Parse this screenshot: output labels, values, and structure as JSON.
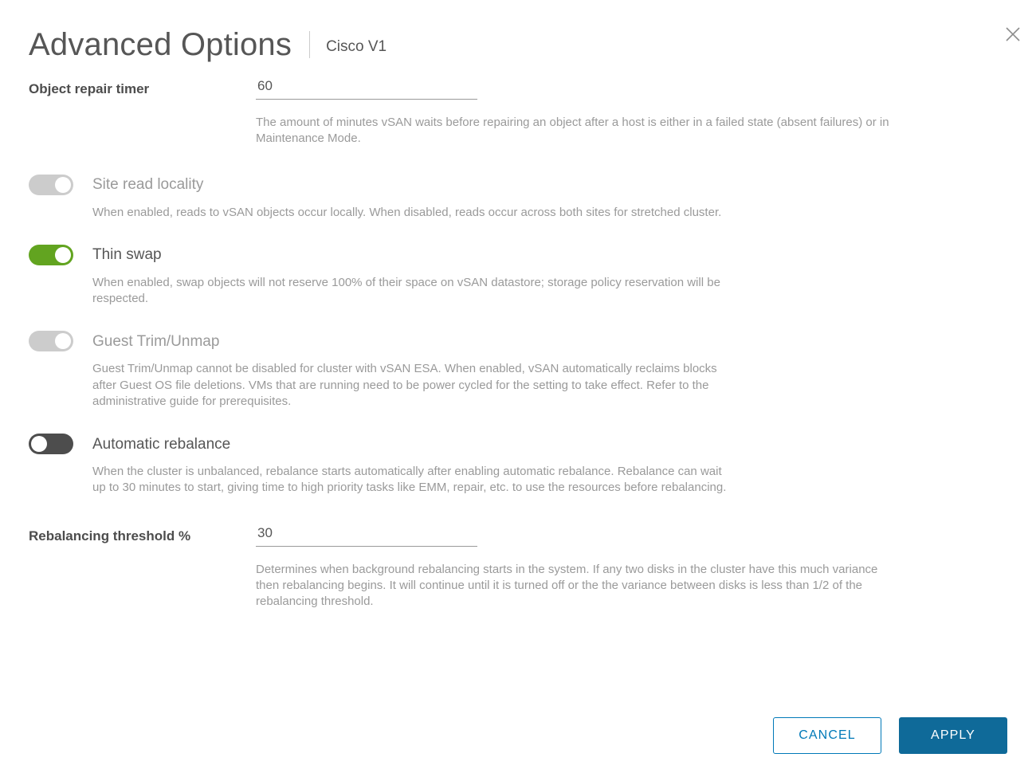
{
  "header": {
    "title": "Advanced Options",
    "subtitle": "Cisco V1",
    "close_icon": "close-icon"
  },
  "fields": {
    "object_repair_timer": {
      "label": "Object repair timer",
      "value": "60",
      "placeholder": "",
      "helper": "The amount of minutes vSAN waits before repairing an object after a host is either in a failed state (absent failures) or in Maintenance Mode."
    },
    "rebalancing_threshold": {
      "label": "Rebalancing threshold %",
      "value": "30",
      "placeholder": "",
      "helper": "Determines when background rebalancing starts in the system. If any two disks in the cluster have this much variance then rebalancing begins. It will continue until it is turned off or the the variance between disks is less than 1/2 of the rebalancing threshold."
    }
  },
  "toggles": {
    "site_read_locality": {
      "label": "Site read locality",
      "state": "on",
      "disabled": true,
      "helper": "When enabled, reads to vSAN objects occur locally. When disabled, reads occur across both sites for stretched cluster."
    },
    "thin_swap": {
      "label": "Thin swap",
      "state": "on",
      "disabled": false,
      "helper": "When enabled, swap objects will not reserve 100% of their space on vSAN datastore; storage policy reservation will be respected."
    },
    "guest_trim_unmap": {
      "label": "Guest Trim/Unmap",
      "state": "on",
      "disabled": true,
      "helper": "Guest Trim/Unmap cannot be disabled for cluster with vSAN ESA. When enabled, vSAN automatically reclaims blocks after Guest OS file deletions. VMs that are running need to be power cycled for the setting to take effect. Refer to the administrative guide for prerequisites."
    },
    "automatic_rebalance": {
      "label": "Automatic rebalance",
      "state": "off",
      "disabled": false,
      "helper": "When the cluster is unbalanced, rebalance starts automatically after enabling automatic rebalance. Rebalance can wait up to 30 minutes to start, giving time to high priority tasks like EMM, repair, etc. to use the resources before rebalancing."
    }
  },
  "footer": {
    "cancel_label": "CANCEL",
    "apply_label": "APPLY"
  },
  "colors": {
    "toggle_on_green": "#62a420",
    "toggle_off_dark": "#4d4d4d",
    "toggle_disabled_gray": "#cccccc",
    "accent_blue": "#0079b8",
    "primary_blue": "#0f6a99",
    "text_dark": "#4d4d4d",
    "text_mid": "#565656",
    "text_light": "#9a9a9a"
  }
}
